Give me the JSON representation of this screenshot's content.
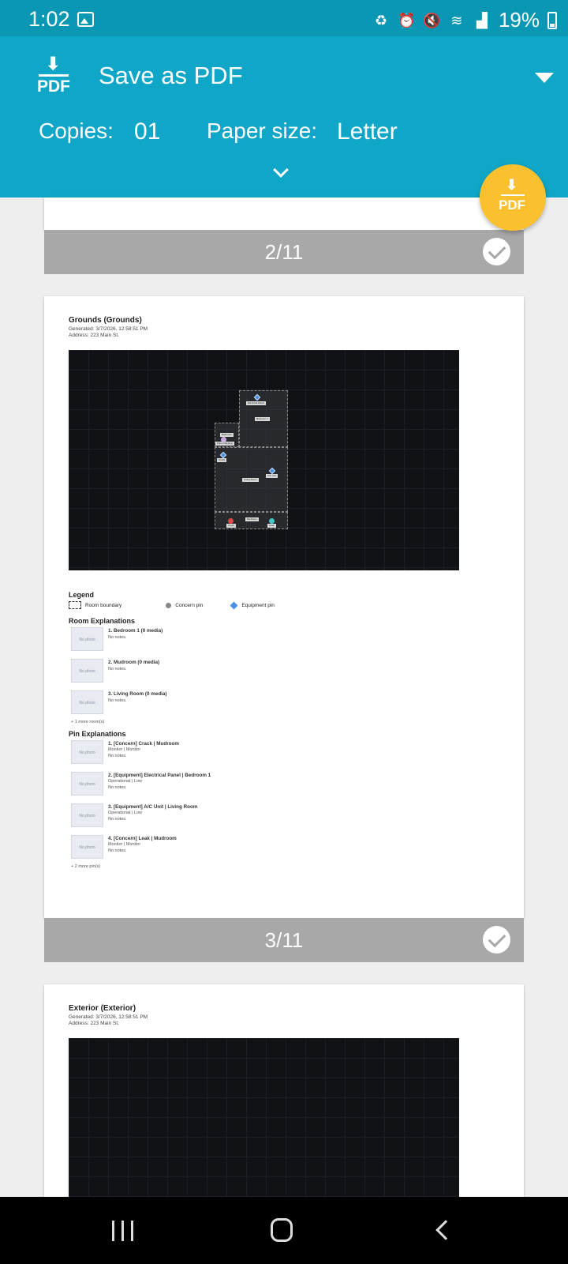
{
  "status_bar": {
    "time": "1:02",
    "battery": "19%"
  },
  "print_header": {
    "logo_text": "PDF",
    "printer": "Save as PDF",
    "copies_label": "Copies:",
    "copies_value": "01",
    "paper_label": "Paper size:",
    "paper_value": "Letter"
  },
  "fab": {
    "label": "PDF"
  },
  "pages": [
    {
      "number": "2/11"
    },
    {
      "number": "3/11",
      "title": "Grounds (Grounds)",
      "generated": "Generated: 3/7/2026, 12:58:51 PM",
      "address": "Address: 223 Main St.",
      "map_labels": {
        "bedroom": "Bedroom 1",
        "electrical": "Electrical Panel",
        "bathroom": "Bathroom",
        "paint": "Paint Chipping",
        "outlet": "Outlet",
        "living": "Living Room",
        "ac": "A/C Unit",
        "mudroom": "Mudroom",
        "crack": "Crack",
        "leak": "Leak"
      },
      "legend": {
        "title": "Legend",
        "room_boundary": "Room boundary",
        "concern_pin": "Concern pin",
        "equipment_pin": "Equipment pin"
      },
      "rooms_title": "Room Explanations",
      "rooms": [
        {
          "title": "1. Bedroom 1 (0 media)",
          "notes": "No notes."
        },
        {
          "title": "2. Mudroom (0 media)",
          "notes": "No notes."
        },
        {
          "title": "3. Living Room (0 media)",
          "notes": "No notes."
        }
      ],
      "rooms_more": "+ 1 more room(s)",
      "pins_title": "Pin Explanations",
      "pins": [
        {
          "title": "1. [Concern] Crack | Mudroom",
          "status": "Monitor | Monitor",
          "notes": "No notes."
        },
        {
          "title": "2. [Equipment] Electrical Panel | Bedroom 1",
          "status": "Operational | Low",
          "notes": "No notes."
        },
        {
          "title": "3. [Equipment] A/C Unit | Living Room",
          "status": "Operational | Low",
          "notes": "No notes."
        },
        {
          "title": "4. [Concern] Leak | Mudroom",
          "status": "Monitor | Monitor",
          "notes": "No notes."
        }
      ],
      "pins_more": "+ 2 more pin(s)",
      "no_photo": "No photo"
    },
    {
      "title": "Exterior (Exterior)",
      "generated": "Generated: 3/7/2026, 12:58:51 PM",
      "address": "Address: 223 Main St."
    }
  ]
}
